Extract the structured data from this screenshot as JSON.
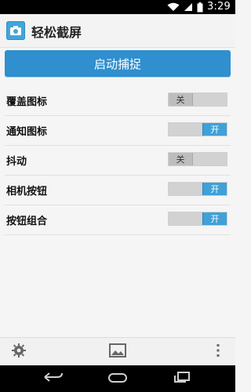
{
  "status": {
    "time": "3:29"
  },
  "app": {
    "title": "轻松截屏"
  },
  "actions": {
    "primary_label": "启动捕捉"
  },
  "settings": [
    {
      "label": "覆盖图标",
      "state": "关",
      "on": false
    },
    {
      "label": "通知图标",
      "state": "开",
      "on": true
    },
    {
      "label": "抖动",
      "state": "关",
      "on": false
    },
    {
      "label": "相机按钮",
      "state": "开",
      "on": true
    },
    {
      "label": "按钮组合",
      "state": "开",
      "on": true
    }
  ],
  "colors": {
    "accent": "#2f8fcf",
    "toggle_on": "#3ea1d8",
    "toggle_off": "#bdbdbd"
  },
  "icons": {
    "toolbar": [
      "gear-icon",
      "image-icon",
      "more-vert-icon"
    ],
    "nav": [
      "back-icon",
      "home-icon",
      "recents-icon"
    ]
  }
}
